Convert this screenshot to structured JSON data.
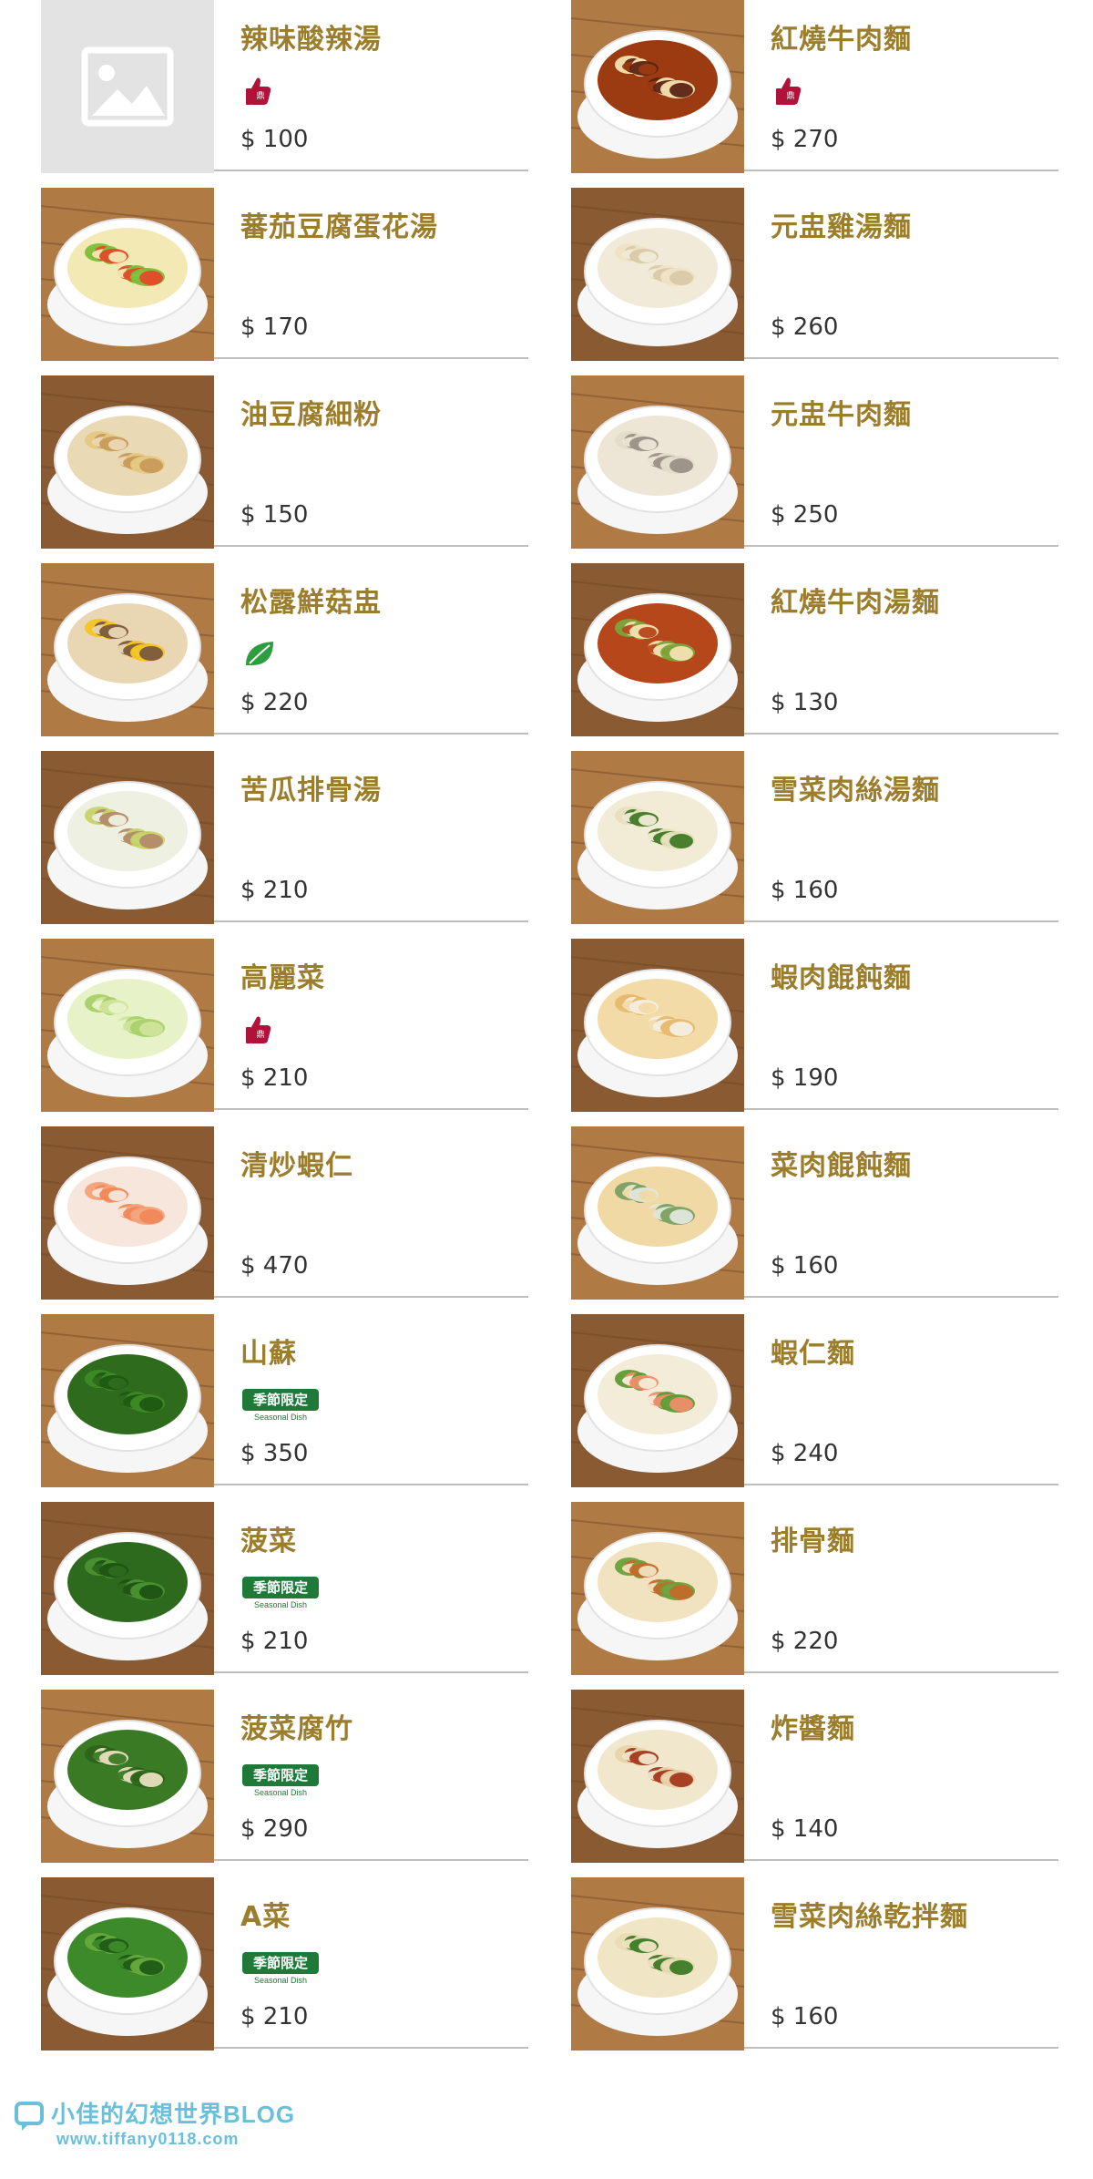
{
  "left_items": [
    {
      "name": "辣味酸辣湯",
      "price": "$ 100",
      "badge": "thumb",
      "image": "placeholder-image"
    },
    {
      "name": "蕃茄豆腐蛋花湯",
      "price": "$ 170",
      "badge": "",
      "image": "tomato-tofu-egg-soup"
    },
    {
      "name": "油豆腐細粉",
      "price": "$ 150",
      "badge": "",
      "image": "fried-tofu-vermicelli"
    },
    {
      "name": "松露鮮菇盅",
      "price": "$ 220",
      "badge": "leaf",
      "image": "truffle-mushroom-soup"
    },
    {
      "name": "苦瓜排骨湯",
      "price": "$ 210",
      "badge": "",
      "image": "bitter-melon-rib-soup"
    },
    {
      "name": "高麗菜",
      "price": "$ 210",
      "badge": "thumb",
      "image": "cabbage"
    },
    {
      "name": "清炒蝦仁",
      "price": "$ 470",
      "badge": "",
      "image": "stir-fried-shrimp"
    },
    {
      "name": "山蘇",
      "price": "$ 350",
      "badge": "season",
      "image": "birds-nest-fern"
    },
    {
      "name": "菠菜",
      "price": "$ 210",
      "badge": "season",
      "image": "spinach"
    },
    {
      "name": "菠菜腐竹",
      "price": "$ 290",
      "badge": "season",
      "image": "spinach-tofu-skin"
    },
    {
      "name": "A菜",
      "price": "$ 210",
      "badge": "season",
      "image": "a-choy"
    }
  ],
  "right_items": [
    {
      "name": "紅燒牛肉麵",
      "price": "$ 270",
      "badge": "thumb",
      "image": "braised-beef-noodle"
    },
    {
      "name": "元盅雞湯麵",
      "price": "$ 260",
      "badge": "",
      "image": "chicken-soup-noodle"
    },
    {
      "name": "元盅牛肉麵",
      "price": "$ 250",
      "badge": "",
      "image": "beef-soup-noodle"
    },
    {
      "name": "紅燒牛肉湯麵",
      "price": "$ 130",
      "badge": "",
      "image": "braised-beef-broth-noodle"
    },
    {
      "name": "雪菜肉絲湯麵",
      "price": "$ 160",
      "badge": "",
      "image": "pickled-greens-pork-noodle"
    },
    {
      "name": "蝦肉餛飩麵",
      "price": "$ 190",
      "badge": "",
      "image": "shrimp-wonton-noodle"
    },
    {
      "name": "菜肉餛飩麵",
      "price": "$ 160",
      "badge": "",
      "image": "veg-pork-wonton-noodle"
    },
    {
      "name": "蝦仁麵",
      "price": "$ 240",
      "badge": "",
      "image": "shrimp-noodle"
    },
    {
      "name": "排骨麵",
      "price": "$ 220",
      "badge": "",
      "image": "pork-chop-noodle"
    },
    {
      "name": "炸醬麵",
      "price": "$ 140",
      "badge": "",
      "image": "zhajiang-noodle"
    },
    {
      "name": "雪菜肉絲乾拌麵",
      "price": "$ 160",
      "badge": "",
      "image": "dry-pickled-greens-noodle"
    }
  ],
  "seasonal_badge": {
    "top": "季節限定",
    "sub": "Seasonal Dish"
  },
  "watermark": {
    "line1": "小佳的幻想世界BLOG",
    "line2": "www.tiffany0118.com"
  },
  "colors": {
    "name": "#9b7d2b",
    "price": "#333333",
    "divider": "#bdbdbd",
    "seasonal": "#1f7a3a",
    "thumb_badge": "#b0123a",
    "leaf": "#2e9d3f",
    "watermark": "#5ab9d8"
  }
}
